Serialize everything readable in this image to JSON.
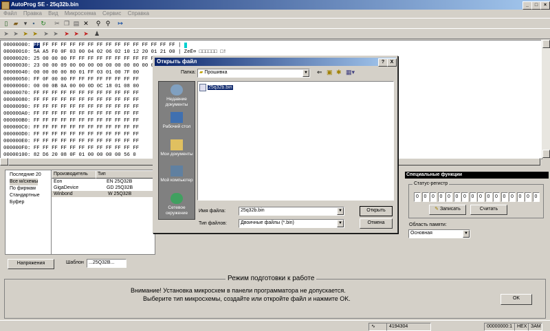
{
  "window": {
    "title": "AutoProg SE - 25q32b.bin"
  },
  "menu": [
    "Файл",
    "Правка",
    "Вид",
    "Микросхема",
    "Сервис",
    "Справка"
  ],
  "hex": {
    "rows": [
      {
        "addr": "00000000:",
        "bytes": "FF FF FF FF FF FF FF FF FF FF FF FF FF FF FF FF",
        "ascii": "|"
      },
      {
        "addr": "00000010:",
        "bytes": "5A A5 F0 0F 03 00 04 02 06 02 10 12 20 01 21 00",
        "ascii": "| ZеЁ¤ □□□□□□ □!"
      },
      {
        "addr": "00000020:",
        "bytes": "25 00 00 00 FF FF FF FF FF FF FF FF FF FF FF FF",
        "ascii": ""
      },
      {
        "addr": "00000030:",
        "bytes": "23 00 00 09 00 00 00 00 00 00 00 00 00 00 00 00",
        "ascii": ""
      },
      {
        "addr": "00000040:",
        "bytes": "00 00 00 00 80 01 FF 03 01 00 7F 00",
        "ascii": ""
      },
      {
        "addr": "00000050:",
        "bytes": "FF 0F 00 00 FF FF FF FF FF FF FF FF",
        "ascii": ""
      },
      {
        "addr": "00000060:",
        "bytes": "00 00 0B 0A 00 00 0D 0C 18 01 08 00",
        "ascii": ""
      },
      {
        "addr": "00000070:",
        "bytes": "FF FF FF FF FF FF FF FF FF FF FF FF",
        "ascii": ""
      },
      {
        "addr": "00000080:",
        "bytes": "FF FF FF FF FF FF FF FF FF FF FF FF",
        "ascii": ""
      },
      {
        "addr": "00000090:",
        "bytes": "FF FF FF FF FF FF FF FF FF FF FF FF",
        "ascii": ""
      },
      {
        "addr": "000000A0:",
        "bytes": "FF FF FF FF FF FF FF FF FF FF FF FF",
        "ascii": ""
      },
      {
        "addr": "000000B0:",
        "bytes": "FF FF FF FF FF FF FF FF FF FF FF FF",
        "ascii": ""
      },
      {
        "addr": "000000C0:",
        "bytes": "FF FF FF FF FF FF FF FF FF FF FF FF",
        "ascii": ""
      },
      {
        "addr": "000000D0:",
        "bytes": "FF FF FF FF FF FF FF FF FF FF FF FF",
        "ascii": ""
      },
      {
        "addr": "000000E0:",
        "bytes": "FF FF FF FF FF FF FF FF FF FF FF FF",
        "ascii": ""
      },
      {
        "addr": "000000F0:",
        "bytes": "FF FF FF FF FF FF FF FF FF FF FF FF",
        "ascii": ""
      },
      {
        "addr": "00000100:",
        "bytes": "82 D6 20 08 0F 01 00 00 00 00 56 0",
        "ascii": ""
      }
    ]
  },
  "tree": {
    "items": [
      "Последние 20",
      "Все м/схемы",
      "По фирмам",
      "Стандартные",
      "Буфер"
    ]
  },
  "chip_table": {
    "headers": [
      "Производитель",
      "Тип"
    ],
    "rows": [
      [
        "Eon",
        "EN 25Q32B"
      ],
      [
        "GigaDevice",
        "GD 25Q32B"
      ],
      [
        "Winbond",
        "W 25Q32B"
      ]
    ]
  },
  "lower": {
    "voltage_button": "Напряжения",
    "template_label": "Шаблон",
    "template_value": "...25Q32B..."
  },
  "special": {
    "title": "Специальные функции",
    "status_register_label": "Статус-регистр",
    "bits": [
      "0",
      "0",
      "0",
      "0",
      "0",
      "0",
      "0",
      "0",
      "0",
      "0",
      "0",
      "0",
      "0",
      "0",
      "0",
      "0"
    ],
    "write_button": "Записать",
    "read_button": "Считать",
    "memory_area_label": "Область памяти:",
    "memory_area_value": "Основная"
  },
  "mode": {
    "title": "Режим подготовки к работе",
    "line1": "Внимание! Установка микросхем в панели программатора не допускается.",
    "line2": "Выберите тип микросхемы, создайте или откройте файл и нажмите OK.",
    "ok_button": "OK"
  },
  "status": {
    "size": "4194304",
    "address": "00000000:1",
    "mode": "HEX",
    "insert": "ЗАМ"
  },
  "dialog": {
    "title": "Открыть файл",
    "folder_label": "Папка:",
    "folder_value": "Прошивка",
    "places": [
      {
        "label": "Недавние документы",
        "icon": "recent-documents-icon"
      },
      {
        "label": "Рабочий стол",
        "icon": "desktop-icon"
      },
      {
        "label": "Мои документы",
        "icon": "my-documents-icon"
      },
      {
        "label": "Мой компьютер",
        "icon": "my-computer-icon"
      },
      {
        "label": "Сетевое окружение",
        "icon": "network-icon"
      }
    ],
    "file": "25q32b.bin",
    "filename_label": "Имя файла:",
    "filename_value": "25q32b.bin",
    "filetype_label": "Тип файлов:",
    "filetype_value": "Двоичные файлы (*.bin)",
    "open_button": "Открыть",
    "cancel_button": "Отмена",
    "help_button": "?",
    "close_button": "X"
  },
  "colors": {
    "title_start": "#0a246a",
    "title_end": "#a6caf0",
    "highlight": "#0a246a",
    "cursor": "#00d0d0"
  }
}
